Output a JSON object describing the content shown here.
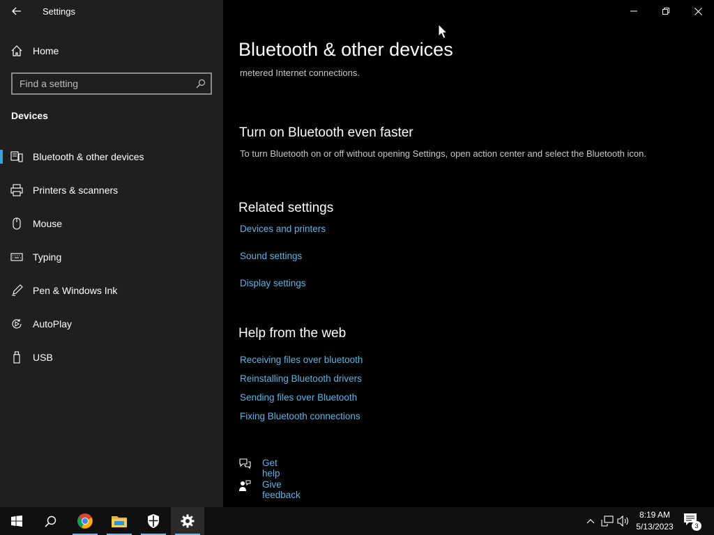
{
  "window": {
    "title": "Settings"
  },
  "sidebar": {
    "home_label": "Home",
    "search_placeholder": "Find a setting",
    "section_title": "Devices",
    "items": [
      {
        "label": "Bluetooth & other devices",
        "icon": "bluetooth-devices-icon",
        "selected": true
      },
      {
        "label": "Printers & scanners",
        "icon": "printer-icon"
      },
      {
        "label": "Mouse",
        "icon": "mouse-icon"
      },
      {
        "label": "Typing",
        "icon": "keyboard-icon"
      },
      {
        "label": "Pen & Windows Ink",
        "icon": "pen-icon"
      },
      {
        "label": "AutoPlay",
        "icon": "autoplay-icon"
      },
      {
        "label": "USB",
        "icon": "usb-icon"
      }
    ],
    "accent_color": "#3aa0d8"
  },
  "main": {
    "title": "Bluetooth & other devices",
    "truncated_text": "metered Internet connections.",
    "faster": {
      "heading": "Turn on Bluetooth even faster",
      "description": "To turn Bluetooth on or off without opening Settings, open action center and select the Bluetooth icon."
    },
    "related": {
      "heading": "Related settings",
      "links": [
        "Devices and printers",
        "Sound settings",
        "Display settings"
      ]
    },
    "help": {
      "heading": "Help from the web",
      "links": [
        "Receiving files over bluetooth",
        "Reinstalling Bluetooth drivers",
        "Sending files over Bluetooth",
        "Fixing Bluetooth connections"
      ]
    },
    "get_help": "Get help",
    "give_feedback": "Give feedback",
    "link_color": "#5eb4e3"
  },
  "taskbar": {
    "apps": [
      "start-icon",
      "search-icon",
      "chrome-icon",
      "file-explorer-icon",
      "windows-security-icon",
      "settings-icon"
    ],
    "tray": [
      "chevron-up-icon",
      "network-icon",
      "volume-icon"
    ],
    "time": "8:19 AM",
    "date": "5/13/2023",
    "notification_count": "3"
  }
}
